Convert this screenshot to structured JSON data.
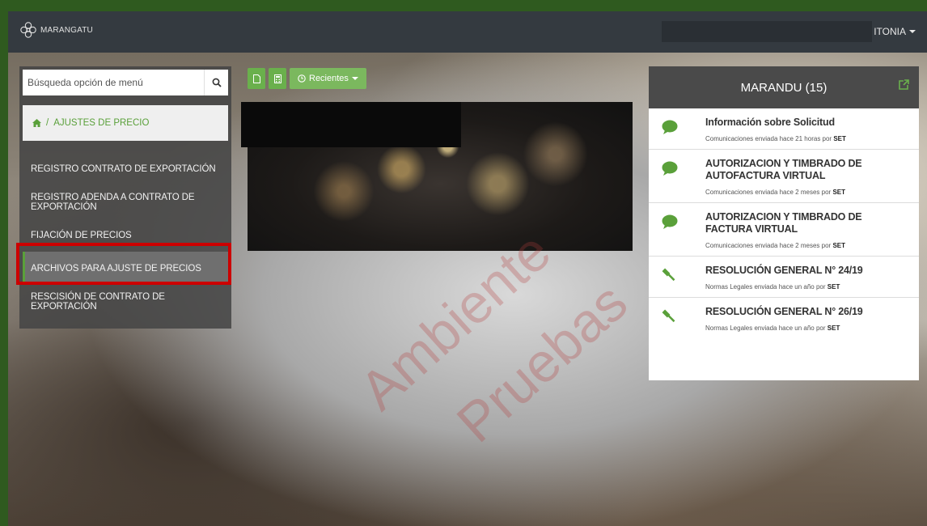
{
  "app": {
    "logo_text": "MARANGATU",
    "user_label": "ITONIA"
  },
  "search": {
    "placeholder": "Búsqueda opción de menú",
    "value": ""
  },
  "breadcrumb": {
    "separator": "/",
    "current": "AJUSTES DE PRECIO"
  },
  "menu": {
    "items": [
      {
        "label": "REGISTRO CONTRATO DE EXPORTACIÓN"
      },
      {
        "label": "REGISTRO ADENDA A CONTRATO DE EXPORTACIÓN"
      },
      {
        "label": "FIJACIÓN DE PRECIOS"
      },
      {
        "label": "ARCHIVOS PARA AJUSTE DE PRECIOS"
      },
      {
        "label": "RESCISIÓN DE CONTRATO DE EXPORTACIÓN"
      }
    ]
  },
  "toolbar": {
    "recent_label": "Recientes"
  },
  "watermark": {
    "line1": "Ambiente",
    "line2": "Pruebas"
  },
  "notifications": {
    "title": "MARANDU (15)",
    "items": [
      {
        "title": "Información sobre Solicitud",
        "meta": "Comunicaciones enviada hace 21 horas por",
        "by": "SET",
        "icon": "speech-bubble-icon"
      },
      {
        "title": "AUTORIZACION Y TIMBRADO DE AUTOFACTURA VIRTUAL",
        "meta": "Comunicaciones enviada hace 2 meses por",
        "by": "SET",
        "icon": "speech-bubble-icon"
      },
      {
        "title": "AUTORIZACION Y TIMBRADO DE FACTURA VIRTUAL",
        "meta": "Comunicaciones enviada hace 2 meses por",
        "by": "SET",
        "icon": "speech-bubble-icon"
      },
      {
        "title": "RESOLUCIÓN GENERAL N° 24/19",
        "meta": "Normas Legales enviada hace un año por",
        "by": "SET",
        "icon": "gavel-icon"
      },
      {
        "title": "RESOLUCIÓN GENERAL N° 26/19",
        "meta": "Normas Legales enviada hace un año por",
        "by": "SET",
        "icon": "gavel-icon"
      }
    ]
  },
  "colors": {
    "accent": "#5aa03a",
    "highlight": "#cc0000",
    "topbar": "#343a40"
  }
}
